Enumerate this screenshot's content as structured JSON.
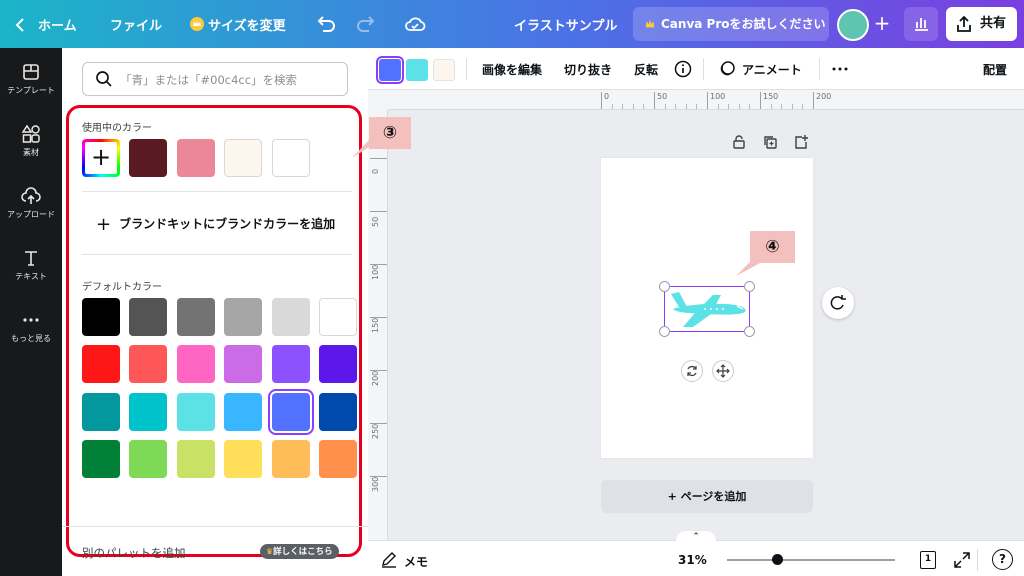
{
  "topbar": {
    "home_label": "ホーム",
    "file_label": "ファイル",
    "resize_label": "サイズを変更",
    "doc_title": "イラストサンプル",
    "pro_label": "Canva Proをお試しください",
    "share_label": "共有"
  },
  "rail": {
    "items": [
      {
        "label": "テンプレート",
        "icon": "template-icon"
      },
      {
        "label": "素材",
        "icon": "elements-icon"
      },
      {
        "label": "アップロード",
        "icon": "upload-icon"
      },
      {
        "label": "テキスト",
        "icon": "text-icon"
      },
      {
        "label": "もっと見る",
        "icon": "more-icon"
      }
    ]
  },
  "panel": {
    "search_placeholder": "「青」または「#00c4cc」を検索",
    "used_colors_title": "使用中のカラー",
    "used_colors": [
      "#5a1a22",
      "#ec8799",
      "#fdf6ee",
      "#ffffff"
    ],
    "add_brand_label": "ブランドキットにブランドカラーを追加",
    "default_colors_title": "デフォルトカラー",
    "default_colors": [
      [
        "#000000",
        "#545454",
        "#737373",
        "#a6a6a6",
        "#d9d9d9",
        "#ffffff"
      ],
      [
        "#ff1616",
        "#ff5757",
        "#ff66c4",
        "#cb6ce6",
        "#8c52ff",
        "#5e17eb"
      ],
      [
        "#03989e",
        "#00c2cb",
        "#5ce1e6",
        "#38b6ff",
        "#5271ff",
        "#004aad"
      ],
      [
        "#008037",
        "#7ed957",
        "#c9e265",
        "#ffde59",
        "#ffbd59",
        "#ff914d"
      ]
    ],
    "selected_default": "#5271ff",
    "add_palette_label": "別のパレットを追加",
    "detail_badge": "詳しくはこちら"
  },
  "toolbar": {
    "swatches": [
      "#5271ff",
      "#5ce1e6",
      "#fdf6ee"
    ],
    "edit_image_label": "画像を編集",
    "crop_label": "切り抜き",
    "flip_label": "反転",
    "animate_label": "アニメート",
    "position_label": "配置"
  },
  "rulers": {
    "h_ticks": [
      "0",
      "50",
      "100",
      "150",
      "200"
    ],
    "v_ticks": [
      "0",
      "50",
      "100",
      "150",
      "200",
      "250",
      "300"
    ]
  },
  "canvas": {
    "add_page_label": "+ ページを追加"
  },
  "annotations": {
    "callout_3": "③",
    "callout_4": "④"
  },
  "bottombar": {
    "notes_label": "メモ",
    "zoom_label": "31%",
    "zoom_fraction": 0.3,
    "page_count": "1",
    "help_label": "?"
  }
}
